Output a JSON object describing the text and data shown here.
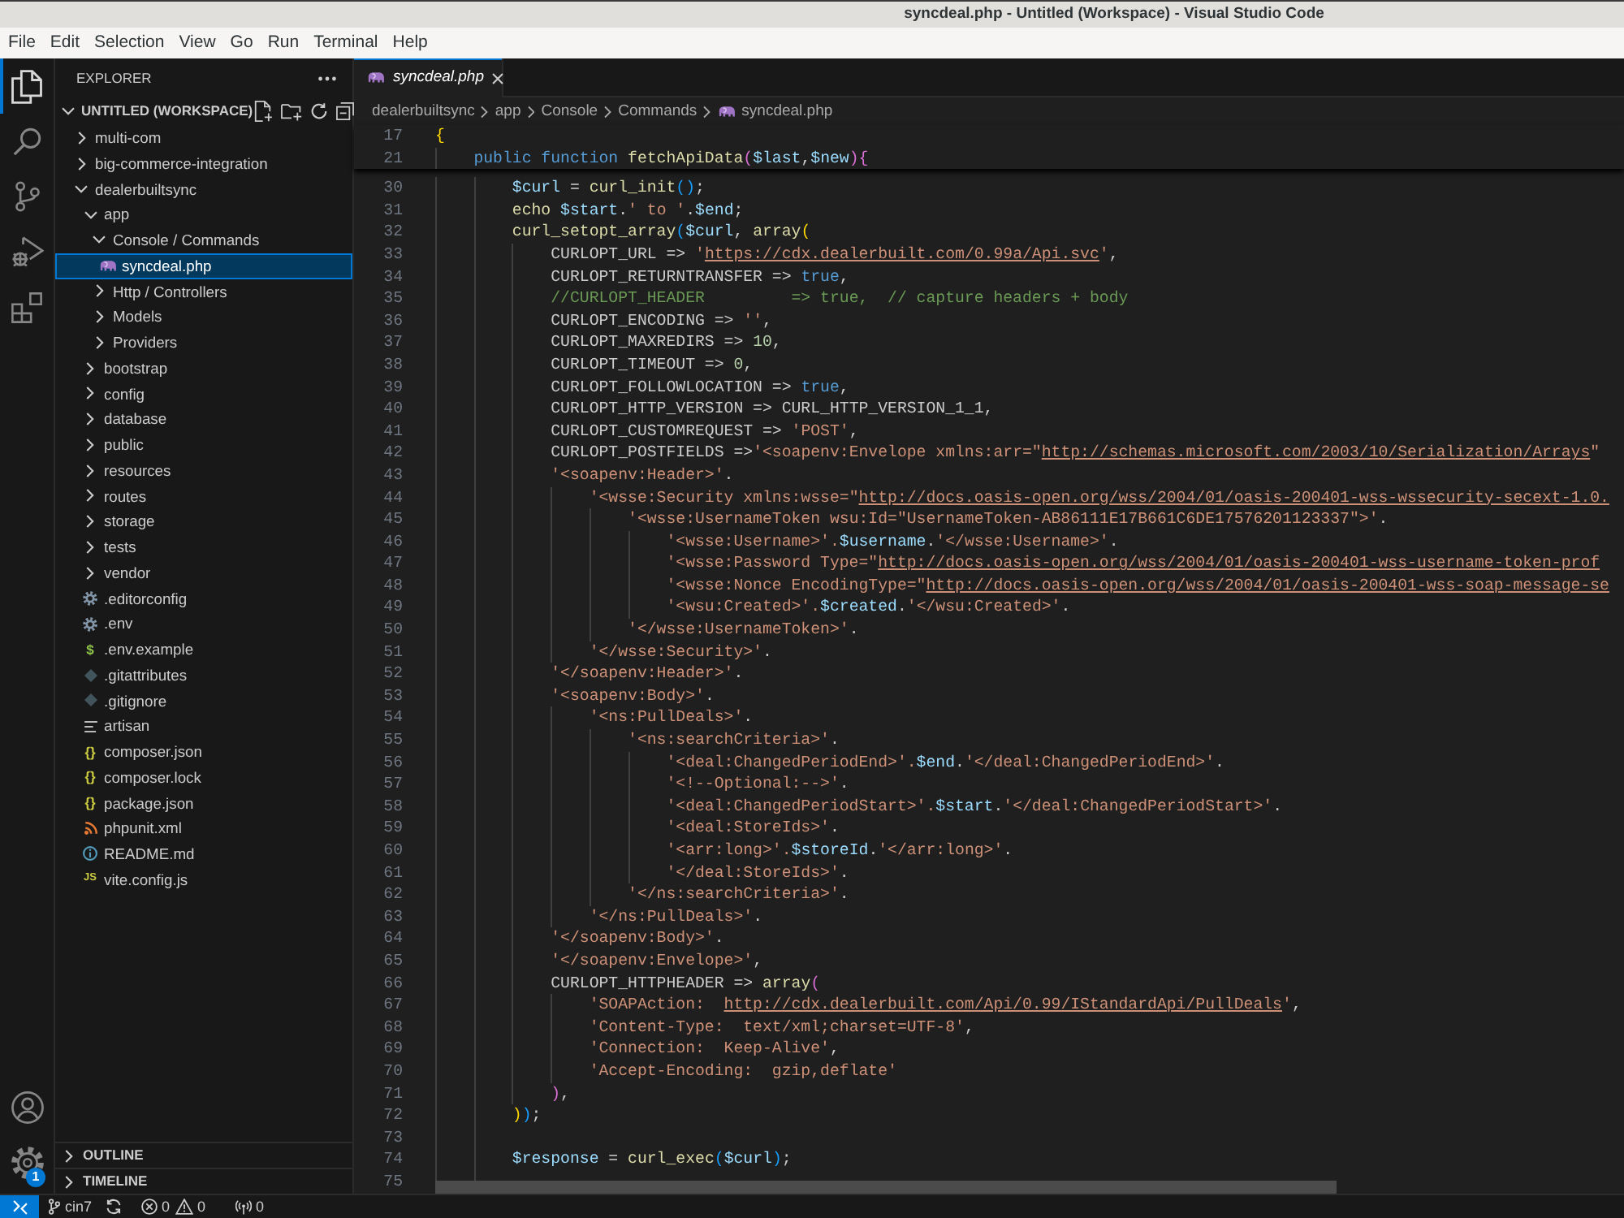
{
  "window": {
    "title": "syncdeal.php - Untitled (Workspace) - Visual Studio Code"
  },
  "menu": [
    "File",
    "Edit",
    "Selection",
    "View",
    "Go",
    "Run",
    "Terminal",
    "Help"
  ],
  "activity_bar": {
    "top": [
      {
        "kind": "explorer",
        "selected": true
      },
      {
        "kind": "search",
        "selected": false
      },
      {
        "kind": "source_control",
        "selected": false
      },
      {
        "kind": "run_debug",
        "selected": false
      },
      {
        "kind": "extensions",
        "selected": false
      }
    ],
    "bottom": [
      {
        "kind": "accounts"
      },
      {
        "kind": "manage",
        "badge": "1"
      }
    ]
  },
  "sidebar": {
    "title": "EXPLORER",
    "workspace": {
      "label": "UNTITLED (WORKSPACE)",
      "expanded": true
    },
    "tree": [
      {
        "kind": "folder",
        "label": "multi-com",
        "expanded": false,
        "selected": false
      },
      {
        "kind": "folder",
        "label": "big-commerce-integration",
        "expanded": false,
        "selected": false
      },
      {
        "kind": "folder",
        "label": "dealerbuiltsync",
        "expanded": true,
        "selected": false,
        "children": [
          {
            "kind": "folder",
            "label": "app",
            "expanded": true,
            "selected": false,
            "children": [
              {
                "kind": "folder",
                "label": "Console / Commands",
                "expanded": true,
                "selected": false,
                "children": [
                  {
                    "kind": "php",
                    "label": "syncdeal.php",
                    "selected": true
                  }
                ]
              },
              {
                "kind": "folder",
                "label": "Http / Controllers",
                "expanded": false,
                "selected": false
              },
              {
                "kind": "folder",
                "label": "Models",
                "expanded": false,
                "selected": false
              },
              {
                "kind": "folder",
                "label": "Providers",
                "expanded": false,
                "selected": false
              }
            ]
          },
          {
            "kind": "folder",
            "label": "bootstrap",
            "expanded": false,
            "selected": false
          },
          {
            "kind": "folder",
            "label": "config",
            "expanded": false,
            "selected": false
          },
          {
            "kind": "folder",
            "label": "database",
            "expanded": false,
            "selected": false
          },
          {
            "kind": "folder",
            "label": "public",
            "expanded": false,
            "selected": false
          },
          {
            "kind": "folder",
            "label": "resources",
            "expanded": false,
            "selected": false
          },
          {
            "kind": "folder",
            "label": "routes",
            "expanded": false,
            "selected": false
          },
          {
            "kind": "folder",
            "label": "storage",
            "expanded": false,
            "selected": false
          },
          {
            "kind": "folder",
            "label": "tests",
            "expanded": false,
            "selected": false
          },
          {
            "kind": "folder",
            "label": "vendor",
            "expanded": false,
            "selected": false
          },
          {
            "kind": "config",
            "label": ".editorconfig",
            "selected": false
          },
          {
            "kind": "config",
            "label": ".env",
            "selected": false
          },
          {
            "kind": "dotenv",
            "label": ".env.example",
            "glyph": "$",
            "selected": false
          },
          {
            "kind": "git",
            "label": ".gitattributes",
            "selected": false
          },
          {
            "kind": "git",
            "label": ".gitignore",
            "selected": false
          },
          {
            "kind": "text",
            "label": "artisan",
            "selected": false
          },
          {
            "kind": "json",
            "label": "composer.json",
            "glyph": "{}",
            "selected": false
          },
          {
            "kind": "json",
            "label": "composer.lock",
            "glyph": "{}",
            "selected": false
          },
          {
            "kind": "json",
            "label": "package.json",
            "glyph": "{}",
            "selected": false
          },
          {
            "kind": "xml",
            "label": "phpunit.xml",
            "selected": false
          },
          {
            "kind": "readme",
            "label": "README.md",
            "selected": false
          },
          {
            "kind": "js",
            "label": "vite.config.js",
            "glyph": "JS",
            "selected": false
          }
        ]
      }
    ],
    "sections": [
      {
        "label": "OUTLINE",
        "expanded": false
      },
      {
        "label": "TIMELINE",
        "expanded": false
      }
    ]
  },
  "editor": {
    "tabs": [
      {
        "label": "syncdeal.php",
        "kind": "php",
        "selected": true,
        "preview": true
      }
    ],
    "breadcrumbs": [
      {
        "label": "dealerbuiltsync"
      },
      {
        "label": "app"
      },
      {
        "label": "Console"
      },
      {
        "label": "Commands"
      },
      {
        "label": "syncdeal.php",
        "kind": "php"
      }
    ],
    "sticky_lines": [
      {
        "n": "17",
        "tokens": [
          {
            "kind": "br1",
            "text": "{"
          }
        ]
      },
      {
        "n": "21",
        "tokens": [
          {
            "kind": "kw",
            "text": "    public function"
          },
          {
            "kind": "fn",
            "text": " fetchApiData"
          },
          {
            "kind": "br2",
            "text": "("
          },
          {
            "kind": "var",
            "text": "$last"
          },
          {
            "kind": "txt",
            "text": ","
          },
          {
            "kind": "var",
            "text": "$new"
          },
          {
            "kind": "br2",
            "text": "){"
          }
        ]
      }
    ],
    "lines": [
      {
        "n": "30",
        "tokens": [
          {
            "kind": "var",
            "text": "        $curl"
          },
          {
            "kind": "txt",
            "text": " = "
          },
          {
            "kind": "fn",
            "text": "curl_init"
          },
          {
            "kind": "br3",
            "text": "()"
          },
          {
            "kind": "txt",
            "text": ";"
          }
        ]
      },
      {
        "n": "31",
        "tokens": [
          {
            "kind": "fn",
            "text": "        echo"
          },
          {
            "kind": "var",
            "text": " $start"
          },
          {
            "kind": "txt",
            "text": "."
          },
          {
            "kind": "str",
            "text": "' to '"
          },
          {
            "kind": "txt",
            "text": "."
          },
          {
            "kind": "var",
            "text": "$end"
          },
          {
            "kind": "txt",
            "text": ";"
          }
        ]
      },
      {
        "n": "32",
        "tokens": [
          {
            "kind": "fn",
            "text": "        curl_setopt_array"
          },
          {
            "kind": "br3",
            "text": "("
          },
          {
            "kind": "var",
            "text": "$curl"
          },
          {
            "kind": "txt",
            "text": ", "
          },
          {
            "kind": "fn",
            "text": "array"
          },
          {
            "kind": "br1",
            "text": "("
          }
        ]
      },
      {
        "n": "33",
        "tokens": [
          {
            "kind": "txt",
            "text": "            CURLOPT_URL => "
          },
          {
            "kind": "str",
            "text": "'"
          },
          {
            "kind": "url",
            "text": "https://cdx.dealerbuilt.com/0.99a/Api.svc"
          },
          {
            "kind": "str",
            "text": "'"
          },
          {
            "kind": "txt",
            "text": ","
          }
        ]
      },
      {
        "n": "34",
        "tokens": [
          {
            "kind": "txt",
            "text": "            CURLOPT_RETURNTRANSFER => "
          },
          {
            "kind": "kw",
            "text": "true"
          },
          {
            "kind": "txt",
            "text": ","
          }
        ]
      },
      {
        "n": "35",
        "tokens": [
          {
            "kind": "com",
            "text": "            //CURLOPT_HEADER         => true,  // capture headers + body"
          }
        ]
      },
      {
        "n": "36",
        "tokens": [
          {
            "kind": "txt",
            "text": "            CURLOPT_ENCODING => "
          },
          {
            "kind": "str",
            "text": "''"
          },
          {
            "kind": "txt",
            "text": ","
          }
        ]
      },
      {
        "n": "37",
        "tokens": [
          {
            "kind": "txt",
            "text": "            CURLOPT_MAXREDIRS => "
          },
          {
            "kind": "num",
            "text": "10"
          },
          {
            "kind": "txt",
            "text": ","
          }
        ]
      },
      {
        "n": "38",
        "tokens": [
          {
            "kind": "txt",
            "text": "            CURLOPT_TIMEOUT => "
          },
          {
            "kind": "num",
            "text": "0"
          },
          {
            "kind": "txt",
            "text": ","
          }
        ]
      },
      {
        "n": "39",
        "tokens": [
          {
            "kind": "txt",
            "text": "            CURLOPT_FOLLOWLOCATION => "
          },
          {
            "kind": "kw",
            "text": "true"
          },
          {
            "kind": "txt",
            "text": ","
          }
        ]
      },
      {
        "n": "40",
        "tokens": [
          {
            "kind": "txt",
            "text": "            CURLOPT_HTTP_VERSION => CURL_HTTP_VERSION_1_1,"
          }
        ]
      },
      {
        "n": "41",
        "tokens": [
          {
            "kind": "txt",
            "text": "            CURLOPT_CUSTOMREQUEST => "
          },
          {
            "kind": "str",
            "text": "'POST'"
          },
          {
            "kind": "txt",
            "text": ","
          }
        ]
      },
      {
        "n": "42",
        "tokens": [
          {
            "kind": "txt",
            "text": "            CURLOPT_POSTFIELDS =>"
          },
          {
            "kind": "str",
            "text": "'<soapenv:Envelope xmlns:arr=\""
          },
          {
            "kind": "url",
            "text": "http://schemas.microsoft.com/2003/10/Serialization/Arrays"
          },
          {
            "kind": "str",
            "text": "\""
          }
        ]
      },
      {
        "n": "43",
        "tokens": [
          {
            "kind": "str",
            "text": "            '<soapenv:Header>'"
          },
          {
            "kind": "txt",
            "text": "."
          }
        ]
      },
      {
        "n": "44",
        "tokens": [
          {
            "kind": "str",
            "text": "                '<wsse:Security xmlns:wsse=\""
          },
          {
            "kind": "url",
            "text": "http://docs.oasis-open.org/wss/2004/01/oasis-200401-wss-wssecurity-secext-1.0."
          }
        ]
      },
      {
        "n": "45",
        "tokens": [
          {
            "kind": "str",
            "text": "                    '<wsse:UsernameToken wsu:Id=\"UsernameToken-AB86111E17B661C6DE17576201123337\">'"
          },
          {
            "kind": "txt",
            "text": "."
          }
        ]
      },
      {
        "n": "46",
        "tokens": [
          {
            "kind": "str",
            "text": "                        '<wsse:Username>'."
          },
          {
            "kind": "var",
            "text": "$username"
          },
          {
            "kind": "txt",
            "text": "."
          },
          {
            "kind": "str",
            "text": "'</wsse:Username>'"
          },
          {
            "kind": "txt",
            "text": "."
          }
        ]
      },
      {
        "n": "47",
        "tokens": [
          {
            "kind": "str",
            "text": "                        '<wsse:Password Type=\""
          },
          {
            "kind": "url",
            "text": "http://docs.oasis-open.org/wss/2004/01/oasis-200401-wss-username-token-prof"
          }
        ]
      },
      {
        "n": "48",
        "tokens": [
          {
            "kind": "str",
            "text": "                        '<wsse:Nonce EncodingType=\""
          },
          {
            "kind": "url",
            "text": "http://docs.oasis-open.org/wss/2004/01/oasis-200401-wss-soap-message-se"
          }
        ]
      },
      {
        "n": "49",
        "tokens": [
          {
            "kind": "str",
            "text": "                        '<wsu:Created>'."
          },
          {
            "kind": "var",
            "text": "$created"
          },
          {
            "kind": "txt",
            "text": "."
          },
          {
            "kind": "str",
            "text": "'</wsu:Created>'"
          },
          {
            "kind": "txt",
            "text": "."
          }
        ]
      },
      {
        "n": "50",
        "tokens": [
          {
            "kind": "str",
            "text": "                    '</wsse:UsernameToken>'"
          },
          {
            "kind": "txt",
            "text": "."
          }
        ]
      },
      {
        "n": "51",
        "tokens": [
          {
            "kind": "str",
            "text": "                '</wsse:Security>'"
          },
          {
            "kind": "txt",
            "text": "."
          }
        ]
      },
      {
        "n": "52",
        "tokens": [
          {
            "kind": "str",
            "text": "            '</soapenv:Header>'"
          },
          {
            "kind": "txt",
            "text": "."
          }
        ]
      },
      {
        "n": "53",
        "tokens": [
          {
            "kind": "str",
            "text": "            '<soapenv:Body>'"
          },
          {
            "kind": "txt",
            "text": "."
          }
        ]
      },
      {
        "n": "54",
        "tokens": [
          {
            "kind": "str",
            "text": "                '<ns:PullDeals>'"
          },
          {
            "kind": "txt",
            "text": "."
          }
        ]
      },
      {
        "n": "55",
        "tokens": [
          {
            "kind": "str",
            "text": "                    '<ns:searchCriteria>'"
          },
          {
            "kind": "txt",
            "text": "."
          }
        ]
      },
      {
        "n": "56",
        "tokens": [
          {
            "kind": "str",
            "text": "                        '<deal:ChangedPeriodEnd>'."
          },
          {
            "kind": "var",
            "text": "$end"
          },
          {
            "kind": "txt",
            "text": "."
          },
          {
            "kind": "str",
            "text": "'</deal:ChangedPeriodEnd>'"
          },
          {
            "kind": "txt",
            "text": "."
          }
        ]
      },
      {
        "n": "57",
        "tokens": [
          {
            "kind": "str",
            "text": "                        '<!--Optional:-->'"
          },
          {
            "kind": "txt",
            "text": "."
          }
        ]
      },
      {
        "n": "58",
        "tokens": [
          {
            "kind": "str",
            "text": "                        '<deal:ChangedPeriodStart>'."
          },
          {
            "kind": "var",
            "text": "$start"
          },
          {
            "kind": "txt",
            "text": "."
          },
          {
            "kind": "str",
            "text": "'</deal:ChangedPeriodStart>'"
          },
          {
            "kind": "txt",
            "text": "."
          }
        ]
      },
      {
        "n": "59",
        "tokens": [
          {
            "kind": "str",
            "text": "                        '<deal:StoreIds>'"
          },
          {
            "kind": "txt",
            "text": "."
          }
        ]
      },
      {
        "n": "60",
        "tokens": [
          {
            "kind": "str",
            "text": "                        '<arr:long>'."
          },
          {
            "kind": "var",
            "text": "$storeId"
          },
          {
            "kind": "txt",
            "text": "."
          },
          {
            "kind": "str",
            "text": "'</arr:long>'"
          },
          {
            "kind": "txt",
            "text": "."
          }
        ]
      },
      {
        "n": "61",
        "tokens": [
          {
            "kind": "str",
            "text": "                        '</deal:StoreIds>'"
          },
          {
            "kind": "txt",
            "text": "."
          }
        ]
      },
      {
        "n": "62",
        "tokens": [
          {
            "kind": "str",
            "text": "                    '</ns:searchCriteria>'"
          },
          {
            "kind": "txt",
            "text": "."
          }
        ]
      },
      {
        "n": "63",
        "tokens": [
          {
            "kind": "str",
            "text": "                '</ns:PullDeals>'"
          },
          {
            "kind": "txt",
            "text": "."
          }
        ]
      },
      {
        "n": "64",
        "tokens": [
          {
            "kind": "str",
            "text": "            '</soapenv:Body>'"
          },
          {
            "kind": "txt",
            "text": "."
          }
        ]
      },
      {
        "n": "65",
        "tokens": [
          {
            "kind": "str",
            "text": "            '</soapenv:Envelope>'"
          },
          {
            "kind": "txt",
            "text": ","
          }
        ]
      },
      {
        "n": "66",
        "tokens": [
          {
            "kind": "txt",
            "text": "            CURLOPT_HTTPHEADER => "
          },
          {
            "kind": "fn",
            "text": "array"
          },
          {
            "kind": "br2",
            "text": "("
          }
        ]
      },
      {
        "n": "67",
        "tokens": [
          {
            "kind": "str",
            "text": "                'SOAPAction:  "
          },
          {
            "kind": "url",
            "text": "http://cdx.dealerbuilt.com/Api/0.99/IStandardApi/PullDeals"
          },
          {
            "kind": "str",
            "text": "'"
          },
          {
            "kind": "txt",
            "text": ","
          }
        ]
      },
      {
        "n": "68",
        "tokens": [
          {
            "kind": "str",
            "text": "                'Content-Type:  text/xml;charset=UTF-8'"
          },
          {
            "kind": "txt",
            "text": ","
          }
        ]
      },
      {
        "n": "69",
        "tokens": [
          {
            "kind": "str",
            "text": "                'Connection:  Keep-Alive'"
          },
          {
            "kind": "txt",
            "text": ","
          }
        ]
      },
      {
        "n": "70",
        "tokens": [
          {
            "kind": "str",
            "text": "                'Accept-Encoding:  gzip,deflate'"
          }
        ]
      },
      {
        "n": "71",
        "tokens": [
          {
            "kind": "br2",
            "text": "            )"
          },
          {
            "kind": "txt",
            "text": ","
          }
        ]
      },
      {
        "n": "72",
        "tokens": [
          {
            "kind": "br1",
            "text": "        )"
          },
          {
            "kind": "br3",
            "text": ")"
          },
          {
            "kind": "txt",
            "text": ";"
          }
        ]
      },
      {
        "n": "73"
      },
      {
        "n": "74",
        "tokens": [
          {
            "kind": "var",
            "text": "        $response"
          },
          {
            "kind": "txt",
            "text": " = "
          },
          {
            "kind": "fn",
            "text": "curl_exec"
          },
          {
            "kind": "br3",
            "text": "("
          },
          {
            "kind": "var",
            "text": "$curl"
          },
          {
            "kind": "br3",
            "text": ")"
          },
          {
            "kind": "txt",
            "text": ";"
          }
        ]
      },
      {
        "n": "75"
      }
    ]
  },
  "status_bar": {
    "branch": "cin7",
    "errors": "0",
    "warnings": "0",
    "ports": "0"
  }
}
